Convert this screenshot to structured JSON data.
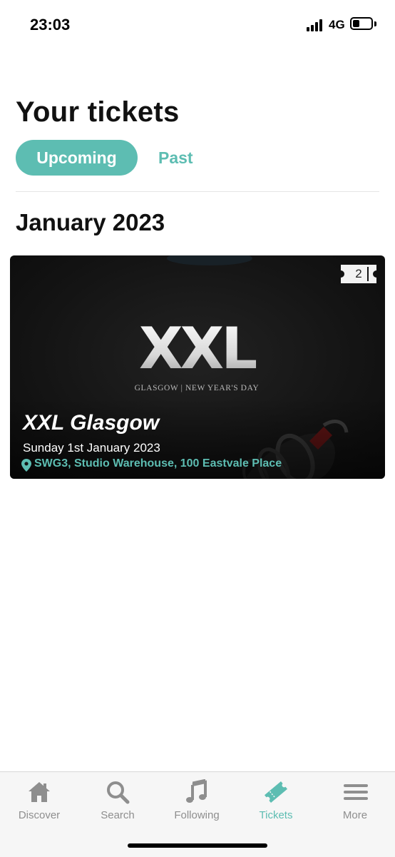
{
  "status_bar": {
    "time": "23:03",
    "network": "4G"
  },
  "page": {
    "title": "Your tickets"
  },
  "tabs": {
    "upcoming": "Upcoming",
    "past": "Past",
    "active": "upcoming"
  },
  "section": {
    "heading": "January 2023"
  },
  "ticket": {
    "artwork_logo": "XXL",
    "artwork_tagline": "GLASGOW | NEW YEAR'S DAY",
    "count": "2",
    "title": "XXL Glasgow",
    "date": "Sunday 1st January 2023",
    "venue": "SWG3, Studio Warehouse, 100 Eastvale Place"
  },
  "bottom_nav": {
    "items": [
      {
        "label": "Discover",
        "icon": "home-icon"
      },
      {
        "label": "Search",
        "icon": "search-icon"
      },
      {
        "label": "Following",
        "icon": "music-note-icon"
      },
      {
        "label": "Tickets",
        "icon": "ticket-icon"
      },
      {
        "label": "More",
        "icon": "menu-icon"
      }
    ],
    "active_index": 3
  },
  "colors": {
    "accent": "#5dbdb2",
    "inactive": "#8e8e8e",
    "card_bg": "#141414"
  }
}
